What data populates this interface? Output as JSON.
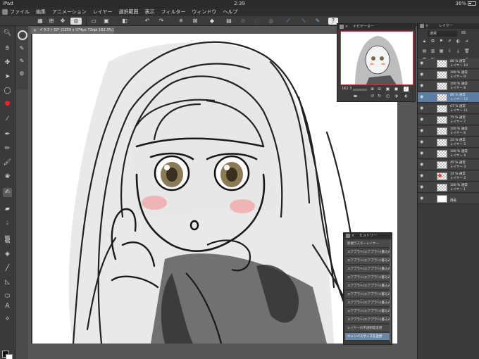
{
  "status_bar": {
    "device": "iPad",
    "time": "2:39",
    "battery": "36%"
  },
  "menu": {
    "items": [
      "ファイル",
      "編集",
      "アニメーション",
      "レイヤー",
      "選択範囲",
      "表示",
      "フィルター",
      "ウィンドウ",
      "ヘルプ"
    ]
  },
  "document": {
    "tab_label": "イラスト32* (1259 x 974px 72dpi 162.3%)"
  },
  "navigator": {
    "title": "ナビゲーター",
    "zoom": "162.3"
  },
  "layers_panel": {
    "title": "レイヤー",
    "blend_mode": "通常",
    "opacity": "86",
    "layers": [
      {
        "opacity": "86 %",
        "blend": "通常",
        "name": "レイヤー 10",
        "selected": false
      },
      {
        "opacity": "100 %",
        "blend": "通常",
        "name": "レイヤー 9",
        "selected": false
      },
      {
        "opacity": "100 %",
        "blend": "通常",
        "name": "レイヤー 8",
        "selected": false
      },
      {
        "opacity": "86 %",
        "blend": "通常",
        "name": "レイヤー 12",
        "selected": true
      },
      {
        "opacity": "67 %",
        "blend": "通常",
        "name": "レイヤー 11",
        "selected": false
      },
      {
        "opacity": "75 %",
        "blend": "通常",
        "name": "レイヤー 7",
        "selected": false
      },
      {
        "opacity": "100 %",
        "blend": "通常",
        "name": "レイヤー 6",
        "selected": false
      },
      {
        "opacity": "33 %",
        "blend": "通常",
        "name": "レイヤー 5",
        "selected": false
      },
      {
        "opacity": "100 %",
        "blend": "通常",
        "name": "レイヤー 4",
        "selected": false
      },
      {
        "opacity": "45 %",
        "blend": "通常",
        "name": "レイヤー 3",
        "selected": false
      },
      {
        "opacity": "14 %",
        "blend": "通常",
        "name": "レイヤー 2",
        "selected": false
      },
      {
        "opacity": "100 %",
        "blend": "通常",
        "name": "レイヤー 1",
        "selected": false
      },
      {
        "opacity": "",
        "blend": "",
        "name": "用紙",
        "selected": false
      }
    ]
  },
  "history_panel": {
    "title": "ヒストリー",
    "items": [
      "新規ラスターレイヤー",
      "エアブラシ(エアブラシ)書込み",
      "エアブラシ(エアブラシ)書込み",
      "エアブラシ(エアブラシ)書込み",
      "エアブラシ(エアブラシ)書込み",
      "エアブラシ(エアブラシ)書込み",
      "エアブラシ(エアブラシ)書込み",
      "エアブラシ(エアブラシ)書込み",
      "エアブラシ(エアブラシ)書込み",
      "エアブラシ(エアブラシ)書込み",
      "レイヤーの不透明度変更",
      "キャンバスサイズを変更"
    ],
    "selected_index": 11
  },
  "colors": {
    "main": "#111111",
    "sub": "#ffffff",
    "selection": "#5d7ea3",
    "navigator_frame": "#cc3333"
  }
}
